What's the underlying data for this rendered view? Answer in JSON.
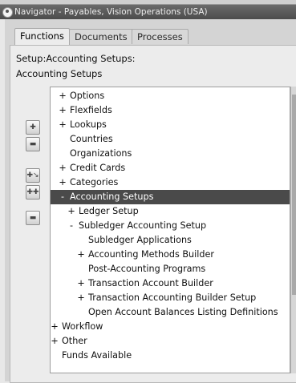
{
  "window": {
    "title": "Navigator - Payables, Vision Operations (USA)"
  },
  "tabs": [
    {
      "label": "Functions",
      "active": true
    },
    {
      "label": "Documents",
      "active": false
    },
    {
      "label": "Processes",
      "active": false
    }
  ],
  "path_label": "Setup:Accounting Setups:",
  "section_label": "Accounting Setups",
  "side_buttons": [
    {
      "name": "expand-button",
      "icon": "plus-icon"
    },
    {
      "name": "collapse-button",
      "icon": "minus-icon"
    },
    {
      "name": "expand-branch-button",
      "icon": "expand-branch-icon"
    },
    {
      "name": "expand-all-button",
      "icon": "expand-all-icon"
    },
    {
      "name": "collapse-all-button",
      "icon": "collapse-all-icon"
    }
  ],
  "tree": [
    {
      "label": "Options",
      "expander": "+",
      "level": 1
    },
    {
      "label": "Flexfields",
      "expander": "+",
      "level": 1
    },
    {
      "label": "Lookups",
      "expander": "+",
      "level": 1
    },
    {
      "label": "Countries",
      "expander": "",
      "level": 1
    },
    {
      "label": "Organizations",
      "expander": "",
      "level": 1
    },
    {
      "label": "Credit Cards",
      "expander": "+",
      "level": 1
    },
    {
      "label": "Categories",
      "expander": "+",
      "level": 1
    },
    {
      "label": "Accounting Setups",
      "expander": "-",
      "level": 1,
      "selected": true
    },
    {
      "label": "Ledger Setup",
      "expander": "+",
      "level": 2
    },
    {
      "label": "Subledger Accounting Setup",
      "expander": "-",
      "level": 2
    },
    {
      "label": "Subledger Applications",
      "expander": "",
      "level": 3
    },
    {
      "label": "Accounting Methods Builder",
      "expander": "+",
      "level": 3
    },
    {
      "label": "Post-Accounting Programs",
      "expander": "",
      "level": 3
    },
    {
      "label": "Transaction Account Builder",
      "expander": "+",
      "level": 3
    },
    {
      "label": "Transaction Accounting Builder Setup",
      "expander": "+",
      "level": 3
    },
    {
      "label": "Open Account Balances Listing Definitions",
      "expander": "",
      "level": 3
    },
    {
      "label": "Workflow",
      "expander": "+",
      "level": 0
    },
    {
      "label": "Other",
      "expander": "+",
      "level": 0
    },
    {
      "label": "Funds Available",
      "expander": "",
      "level": 0
    }
  ],
  "colors": {
    "selected_row": "#4a4a4a",
    "title_bar": "#5a5a5a"
  }
}
